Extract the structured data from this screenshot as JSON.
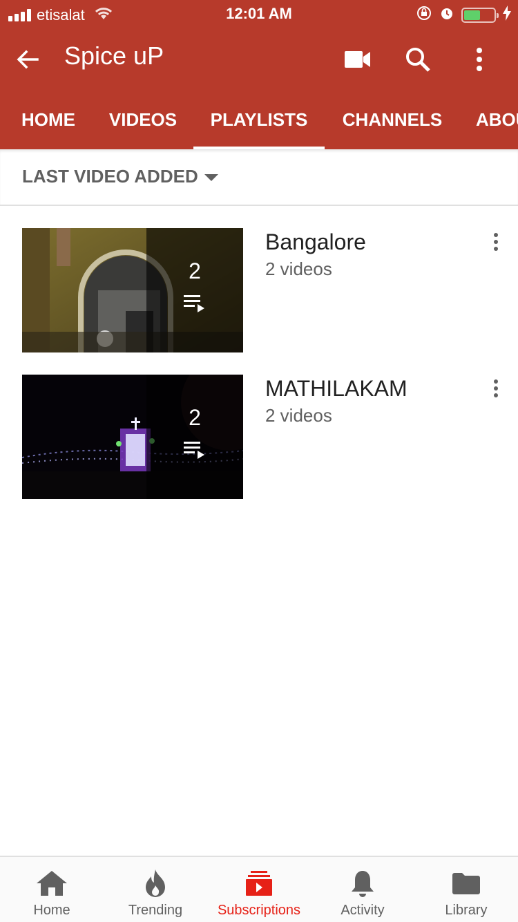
{
  "status_bar": {
    "carrier": "etisalat",
    "time": "12:01 AM",
    "battery_level": 0.55
  },
  "toolbar": {
    "title": "Spice uP",
    "icons": [
      "back-arrow-icon",
      "video-camera-icon",
      "search-icon",
      "more-vertical-icon"
    ]
  },
  "tabs": [
    {
      "label": "HOME"
    },
    {
      "label": "VIDEOS"
    },
    {
      "label": "PLAYLISTS",
      "active": true
    },
    {
      "label": "CHANNELS"
    },
    {
      "label": "ABOU"
    }
  ],
  "sort": {
    "label": "LAST VIDEO ADDED"
  },
  "playlists": [
    {
      "title": "Bangalore",
      "subtitle": "2 videos",
      "count": "2"
    },
    {
      "title": "MATHILAKAM",
      "subtitle": "2 videos",
      "count": "2"
    }
  ],
  "bottom_nav": [
    {
      "label": "Home",
      "icon": "home-icon"
    },
    {
      "label": "Trending",
      "icon": "flame-icon"
    },
    {
      "label": "Subscriptions",
      "icon": "subscriptions-icon",
      "active": true
    },
    {
      "label": "Activity",
      "icon": "bell-icon"
    },
    {
      "label": "Library",
      "icon": "folder-icon"
    }
  ],
  "colors": {
    "app_bar": "#b73a2b",
    "active_nav": "#e62117"
  }
}
